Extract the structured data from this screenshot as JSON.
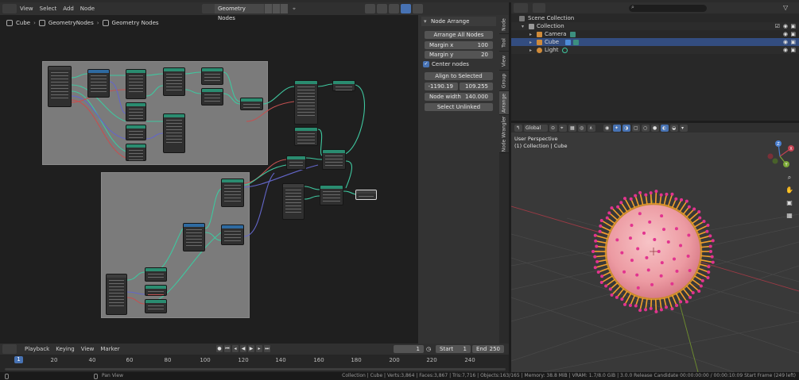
{
  "node_editor": {
    "menus": [
      "View",
      "Select",
      "Add",
      "Node"
    ],
    "tree_name": "Geometry Nodes",
    "breadcrumb": [
      "Cube",
      "GeometryNodes",
      "Geometry Nodes"
    ]
  },
  "sidebar_tabs": [
    "Node",
    "Tool",
    "View",
    "Group",
    "Arrange",
    "Node Wrangler"
  ],
  "node_arrange": {
    "title": "Node Arrange",
    "arrange_all": "Arrange All Nodes",
    "margin_x_label": "Margin x",
    "margin_x": "100",
    "margin_y_label": "Margin y",
    "margin_y": "20",
    "center_nodes_label": "Center nodes",
    "center_nodes_checked": true,
    "align_label": "Align to Selected",
    "pos_x": "-1190.19",
    "pos_y": "109.255",
    "node_width_label": "Node width",
    "node_width": "140.000",
    "select_unlinked": "Select Unlinked"
  },
  "timeline": {
    "menus": [
      "Playback",
      "Keying",
      "View",
      "Marker"
    ],
    "current_frame": "1",
    "start_label": "Start",
    "start": "1",
    "end_label": "End",
    "end": "250",
    "ticks": [
      "20",
      "40",
      "60",
      "80",
      "100",
      "120",
      "140",
      "160",
      "180",
      "200",
      "220",
      "240"
    ],
    "cursor_label": "1"
  },
  "status_bar": {
    "pan": "Pan View",
    "stats": "Collection | Cube | Verts:3,864 | Faces:3,867 | Tris:7,716 | Objects:163/165 | Memory: 38.8 MiB | VRAM: 1.7/8.0 GiB | 3.0.0 Release Candidate  00:00:00:00 / 00:00:10:09  Start Frame (249 left)"
  },
  "outliner": {
    "items": [
      {
        "label": "Scene Collection",
        "icon": "scene-collection-icon"
      },
      {
        "label": "Collection",
        "icon": "collection-icon"
      },
      {
        "label": "Camera",
        "icon": "camera-icon"
      },
      {
        "label": "Cube",
        "icon": "mesh-icon"
      },
      {
        "label": "Light",
        "icon": "light-icon"
      }
    ]
  },
  "viewport": {
    "orientation": "Global",
    "info_line1": "User Perspective",
    "info_line2": "(1) Collection | Cube",
    "gizmo_axes": [
      "X",
      "Y",
      "Z"
    ]
  },
  "colors": {
    "accent": "#4772b3",
    "node_socket_green": "#3fc79f",
    "node_socket_purple": "#6366c9",
    "wire_red": "#c35050",
    "sphere_pink": "#f0a0a8",
    "spike_orange": "#f2a02c",
    "spike_tip_magenta": "#e2338f"
  }
}
